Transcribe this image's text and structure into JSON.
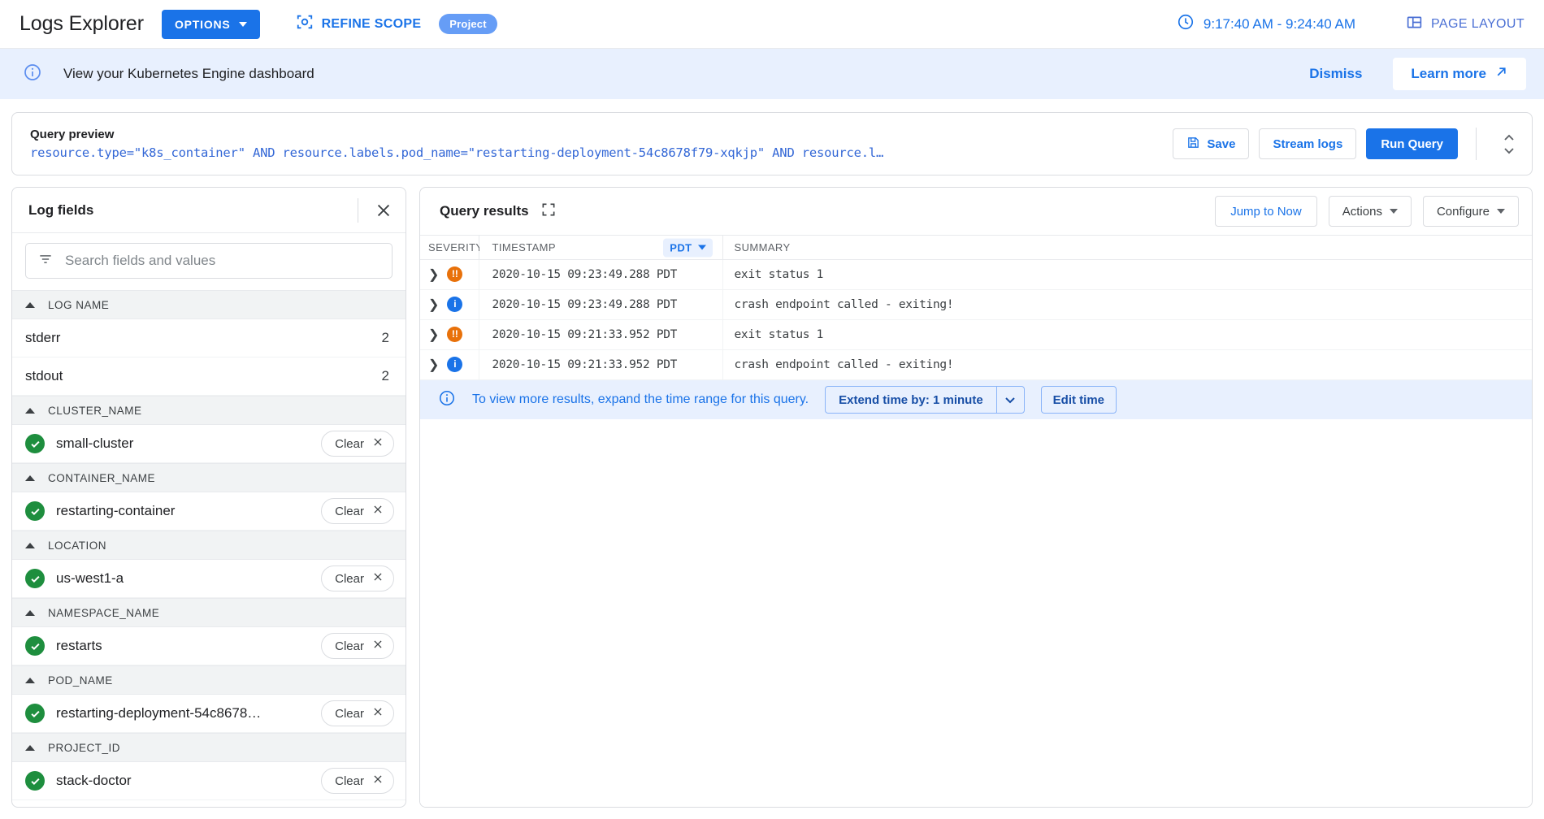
{
  "topbar": {
    "app_title": "Logs Explorer",
    "options_label": "OPTIONS",
    "refine_scope_label": "REFINE SCOPE",
    "scope_chip": "Project",
    "time_range": "9:17:40 AM - 9:24:40 AM",
    "page_layout_label": "PAGE LAYOUT",
    "icons": {
      "options_caret": "chevron-down-icon",
      "refine_scope": "scope-target-icon",
      "clock": "clock-icon",
      "page_layout": "page-layout-icon"
    },
    "accent_color": "#1a73e8"
  },
  "banner": {
    "icon": "info-icon",
    "text": "View your Kubernetes Engine dashboard",
    "dismiss_label": "Dismiss",
    "learn_more_label": "Learn more",
    "learn_more_icon": "external-link-icon",
    "background": "#e8f0fe"
  },
  "query_preview": {
    "label": "Query preview",
    "query": "resource.type=\"k8s_container\" AND resource.labels.pod_name=\"restarting-deployment-54c8678f79-xqkjp\" AND resource.l…",
    "save_label": "Save",
    "save_icon": "save-icon",
    "stream_logs_label": "Stream logs",
    "run_query_label": "Run Query",
    "expand_icon": "expand-collapse-icon"
  },
  "log_fields": {
    "title": "Log fields",
    "close_icon": "close-icon",
    "search_placeholder": "Search fields and values",
    "search_value": "",
    "search_icon": "filter-icon",
    "collapse_icon": "chevron-up-icon",
    "check_icon": "check-circle-icon",
    "clear_label": "Clear",
    "clear_icon": "close-icon",
    "sections": [
      {
        "title": "LOG NAME",
        "rows": [
          {
            "name": "stderr",
            "count": "2",
            "selected": false
          },
          {
            "name": "stdout",
            "count": "2",
            "selected": false
          }
        ]
      },
      {
        "title": "CLUSTER_NAME",
        "rows": [
          {
            "name": "small-cluster",
            "count": "",
            "selected": true
          }
        ]
      },
      {
        "title": "CONTAINER_NAME",
        "rows": [
          {
            "name": "restarting-container",
            "count": "",
            "selected": true
          }
        ]
      },
      {
        "title": "LOCATION",
        "rows": [
          {
            "name": "us-west1-a",
            "count": "",
            "selected": true
          }
        ]
      },
      {
        "title": "NAMESPACE_NAME",
        "rows": [
          {
            "name": "restarts",
            "count": "",
            "selected": true
          }
        ]
      },
      {
        "title": "POD_NAME",
        "rows": [
          {
            "name": "restarting-deployment-54c8678…",
            "count": "",
            "selected": true
          }
        ]
      },
      {
        "title": "PROJECT_ID",
        "rows": [
          {
            "name": "stack-doctor",
            "count": "",
            "selected": true
          }
        ]
      }
    ]
  },
  "query_results": {
    "title": "Query results",
    "fullscreen_icon": "fullscreen-icon",
    "jump_to_now_label": "Jump to Now",
    "actions_label": "Actions",
    "configure_label": "Configure",
    "columns": {
      "severity": "SEVERITY",
      "timestamp": "TIMESTAMP",
      "summary": "SUMMARY",
      "timezone_chip": "PDT"
    },
    "rows": [
      {
        "severity": "error",
        "severity_icon": "error-severity-icon",
        "timestamp": "2020-10-15 09:23:49.288 PDT",
        "summary": "exit status 1"
      },
      {
        "severity": "info",
        "severity_icon": "info-severity-icon",
        "timestamp": "2020-10-15 09:23:49.288 PDT",
        "summary": "crash endpoint called - exiting!"
      },
      {
        "severity": "error",
        "severity_icon": "error-severity-icon",
        "timestamp": "2020-10-15 09:21:33.952 PDT",
        "summary": "exit status 1"
      },
      {
        "severity": "info",
        "severity_icon": "info-severity-icon",
        "timestamp": "2020-10-15 09:21:33.952 PDT",
        "summary": "crash endpoint called - exiting!"
      }
    ],
    "note": {
      "icon": "info-icon",
      "text": "To view more results, expand the time range for this query.",
      "extend_label": "Extend time by: 1 minute",
      "extend_caret_icon": "chevron-down-icon",
      "edit_time_label": "Edit time"
    }
  }
}
